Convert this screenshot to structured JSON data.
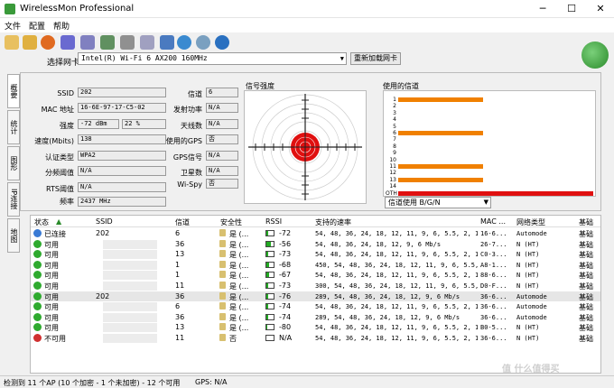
{
  "window": {
    "title": "WirelessMon Professional",
    "min": "─",
    "max": "☐",
    "close": "✕"
  },
  "menu": [
    "文件",
    "配置",
    "帮助"
  ],
  "toolbar_icons": [
    "folder-icon",
    "open-icon",
    "record-icon",
    "stop-icon",
    "print-icon",
    "export-icon",
    "settings-icon",
    "check-icon",
    "globe-icon",
    "wifi-icon",
    "help-icon"
  ],
  "nic": {
    "label": "选择网卡",
    "value": "Intel(R) Wi-Fi 6 AX200 160MHz",
    "reload": "重新加载网卡"
  },
  "tabs": [
    "概要",
    "统计",
    "图形",
    "IP连接",
    "地图"
  ],
  "info": {
    "left": [
      {
        "label": "SSID",
        "value": "202"
      },
      {
        "label": "MAC 地址",
        "value": "16-6E-97-17-C5-02"
      },
      {
        "label": "强度",
        "value": "-72 dBm",
        "extra": "22 %"
      },
      {
        "label": "速度(Mbits)",
        "value": "138"
      },
      {
        "label": "认证类型",
        "value": "WPA2"
      },
      {
        "label": "分频阈值",
        "value": "N/A"
      },
      {
        "label": "RTS阈值",
        "value": "N/A"
      },
      {
        "label": "频率",
        "value": "2437 MHz"
      }
    ],
    "right": [
      {
        "label": "信道",
        "value": "6"
      },
      {
        "label": "发射功率",
        "value": "N/A"
      },
      {
        "label": "天线数",
        "value": "N/A"
      },
      {
        "label": "使用的GPS",
        "value": "否"
      },
      {
        "label": "GPS信号",
        "value": "N/A"
      },
      {
        "label": "卫星数",
        "value": "N/A"
      },
      {
        "label": "Wi-Spy",
        "value": "否"
      }
    ]
  },
  "signal_title": "信号强度",
  "channels": {
    "title": "使用的信道",
    "labels": [
      "1",
      "2",
      "3",
      "4",
      "5",
      "6",
      "7",
      "8",
      "9",
      "10",
      "11",
      "12",
      "13",
      "14",
      "OTH"
    ],
    "bars": [
      {
        "ch": "1",
        "fill": 0.65,
        "color": "#f08000"
      },
      {
        "ch": "6",
        "fill": 0.65,
        "color": "#f08000"
      },
      {
        "ch": "11",
        "fill": 0.65,
        "color": "#f08000"
      },
      {
        "ch": "13",
        "fill": 0.65,
        "color": "#f08000"
      },
      {
        "ch": "OTH",
        "fill": 1.0,
        "color": "#e01010"
      }
    ],
    "select": "信道使用 B/G/N"
  },
  "table": {
    "headers": [
      "状态",
      "SSID",
      "信道",
      "安全性",
      "RSSI",
      "支持的速率",
      "MAC ...",
      "网络类型",
      "基础"
    ],
    "rows": [
      {
        "status": "已连接",
        "dot": "#3a7bd5",
        "ssid": "202",
        "ch": "6",
        "sec": "是 (...",
        "rssi": "-72",
        "rssi_fill": 0.3,
        "rates": "54, 48, 36, 24, 18, 12, 11, 9, 6, 5.5, 2, 1 Mb/s",
        "mac": "16-6...",
        "type": "Automode",
        "base": "基础"
      },
      {
        "status": "可用",
        "dot": "#2faa2f",
        "ssid": "",
        "ch": "36",
        "sec": "是 (...",
        "rssi": "-56",
        "rssi_fill": 0.6,
        "rates": "54, 48, 36, 24, 18, 12, 9, 6 Mb/s",
        "mac": "26-7...",
        "type": "N (HT)",
        "base": "基础"
      },
      {
        "status": "可用",
        "dot": "#2faa2f",
        "ssid": "",
        "ch": "13",
        "sec": "是 (...",
        "rssi": "-73",
        "rssi_fill": 0.3,
        "rates": "54, 48, 36, 24, 18, 12, 11, 9, 6, 5.5, 2, 1 Mb/s",
        "mac": "C0-3...",
        "type": "N (HT)",
        "base": "基础"
      },
      {
        "status": "可用",
        "dot": "#2faa2f",
        "ssid": "",
        "ch": "1",
        "sec": "是 (...",
        "rssi": "-68",
        "rssi_fill": 0.4,
        "rates": "450, 54, 48, 36, 24, 18, 12, 11, 9, 6, 5.5, 2, 1 Mb/s",
        "mac": "A8-1...",
        "type": "N (HT)",
        "base": "基础"
      },
      {
        "status": "可用",
        "dot": "#2faa2f",
        "ssid": "",
        "ch": "1",
        "sec": "是 (...",
        "rssi": "-67",
        "rssi_fill": 0.4,
        "rates": "54, 48, 36, 24, 18, 12, 11, 9, 6, 5.5, 2, 1 Mb/s",
        "mac": "88-6...",
        "type": "N (HT)",
        "base": "基础"
      },
      {
        "status": "可用",
        "dot": "#2faa2f",
        "ssid": "",
        "ch": "11",
        "sec": "是 (...",
        "rssi": "-73",
        "rssi_fill": 0.3,
        "rates": "300, 54, 48, 36, 24, 18, 12, 11, 9, 6, 5.5, 2, 1 Mb/s",
        "mac": "D0-F...",
        "type": "N (HT)",
        "base": "基础"
      },
      {
        "status": "可用",
        "dot": "#2faa2f",
        "ssid": "202",
        "ch": "36",
        "sec": "是 (...",
        "rssi": "-76",
        "rssi_fill": 0.2,
        "rates": "289, 54, 48, 36, 24, 18, 12, 9, 6 Mb/s",
        "mac": "36-6...",
        "type": "Automode",
        "base": "基础",
        "sel": true
      },
      {
        "status": "可用",
        "dot": "#2faa2f",
        "ssid": "",
        "ch": "6",
        "sec": "是 (...",
        "rssi": "-74",
        "rssi_fill": 0.25,
        "rates": "54, 48, 36, 24, 18, 12, 11, 9, 6, 5.5, 2, 1 Mb/s",
        "mac": "36-6...",
        "type": "Automode",
        "base": "基础"
      },
      {
        "status": "可用",
        "dot": "#2faa2f",
        "ssid": "",
        "ch": "36",
        "sec": "是 (...",
        "rssi": "-74",
        "rssi_fill": 0.25,
        "rates": "289, 54, 48, 36, 24, 18, 12, 9, 6 Mb/s",
        "mac": "36-6...",
        "type": "Automode",
        "base": "基础"
      },
      {
        "status": "可用",
        "dot": "#2faa2f",
        "ssid": "",
        "ch": "13",
        "sec": "是 (...",
        "rssi": "-80",
        "rssi_fill": 0.15,
        "rates": "54, 48, 36, 24, 18, 12, 11, 9, 6, 5.5, 2, 1 Mb/s",
        "mac": "B0-5...",
        "type": "N (HT)",
        "base": "基础"
      },
      {
        "status": "不可用",
        "dot": "#d03030",
        "ssid": "",
        "ch": "11",
        "sec": "否",
        "rssi": "N/A",
        "rssi_fill": 0,
        "rates": "54, 48, 36, 24, 18, 12, 11, 9, 6, 5.5, 2, 1 Mb/s",
        "mac": "36-6...",
        "type": "N (HT)",
        "base": "基础"
      }
    ]
  },
  "status": {
    "left": "检测到 11 个AP (10 个加密 - 1 个未加密) - 12 个可用",
    "gps": "GPS: N/A"
  },
  "watermark": "值 什么值得买"
}
